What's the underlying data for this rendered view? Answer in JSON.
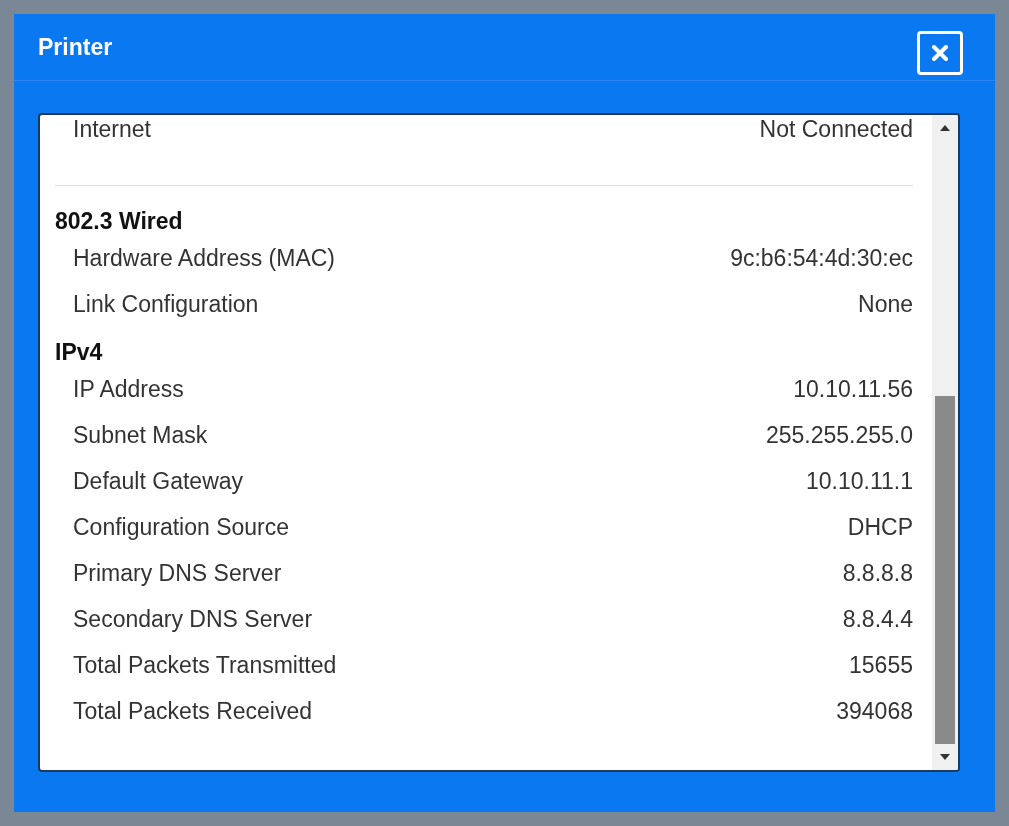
{
  "window": {
    "title": "Printer"
  },
  "top_row": {
    "label": "Internet",
    "value": "Not Connected"
  },
  "sections": [
    {
      "heading": "802.3 Wired",
      "rows": [
        {
          "label": "Hardware Address (MAC)",
          "value": "9c:b6:54:4d:30:ec"
        },
        {
          "label": "Link Configuration",
          "value": "None"
        }
      ]
    },
    {
      "heading": "IPv4",
      "rows": [
        {
          "label": "IP Address",
          "value": "10.10.11.56"
        },
        {
          "label": "Subnet Mask",
          "value": "255.255.255.0"
        },
        {
          "label": "Default Gateway",
          "value": "10.10.11.1"
        },
        {
          "label": "Configuration Source",
          "value": "DHCP"
        },
        {
          "label": "Primary DNS Server",
          "value": "8.8.8.8"
        },
        {
          "label": "Secondary DNS Server",
          "value": "8.8.4.4"
        },
        {
          "label": "Total Packets Transmitted",
          "value": "15655"
        },
        {
          "label": "Total Packets Received",
          "value": "394068"
        }
      ]
    }
  ]
}
